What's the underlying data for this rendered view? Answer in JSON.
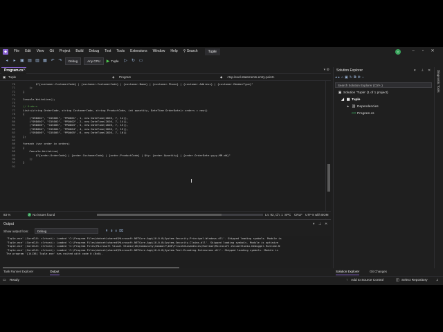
{
  "menu": {
    "items": [
      "File",
      "Edit",
      "View",
      "Git",
      "Project",
      "Build",
      "Debug",
      "Test",
      "Tools",
      "Extensions",
      "Window",
      "Help"
    ],
    "search_label": "Search",
    "solution_title": "Tuple",
    "avatar_initial": "T"
  },
  "toolbar": {
    "config": "Debug",
    "platform": "Any CPU",
    "run_label": "Tuple"
  },
  "editor": {
    "tab_label": "Program.cs",
    "nav_project": "Tuple",
    "nav_type": "Program",
    "nav_member": "<top-level-statements-entry-point>",
    "lines": [
      {
        "n": "70",
        "t": "        $\"{customer.CustomerCode} | {customer.CustomerCode} | {customer.Name} | {customer.Phone} | {customer.Address} | {customer.MemberType}\"",
        "c": ""
      },
      {
        "n": "71",
        "t": "    );",
        "c": ""
      },
      {
        "n": "72",
        "t": "}",
        "c": ""
      },
      {
        "n": "73",
        "t": "",
        "c": ""
      },
      {
        "n": "74",
        "t": "Console.WriteLine();",
        "c": ""
      },
      {
        "n": "75",
        "t": "",
        "c": ""
      },
      {
        "n": "76",
        "t": "// Orders",
        "c": "comment"
      },
      {
        "n": "77",
        "t": "List<(string OrderCode, string CustomerCode, string ProductCode, int quantity, DateTime OrderDate)> orders = new()",
        "c": ""
      },
      {
        "n": "78",
        "t": "{",
        "c": ""
      },
      {
        "n": "79",
        "t": "    (\"ORD001\", \"CUS001\", \"PRD001\", 1, new DateTime(2026, 7, 14)),",
        "c": ""
      },
      {
        "n": "80",
        "t": "    (\"ORD002\", \"CUS002\", \"PRD002\", 2, new DateTime(2026, 7, 14)),",
        "c": ""
      },
      {
        "n": "81",
        "t": "    (\"ORD003\", \"CUS003\", \"PRD003\", 5, new DateTime(2026, 7, 15)),",
        "c": ""
      },
      {
        "n": "82",
        "t": "    (\"ORD004\", \"CUS004\", \"PRD004\", 4, new DateTime(2026, 7, 15)),",
        "c": ""
      },
      {
        "n": "83",
        "t": "    (\"ORD005\", \"CUS005\", \"PRD005\", 6, new DateTime(2026, 7, 16))",
        "c": ""
      },
      {
        "n": "84",
        "t": "};",
        "c": ""
      },
      {
        "n": "85",
        "t": "",
        "c": ""
      },
      {
        "n": "86",
        "t": "foreach (var order in orders)",
        "c": ""
      },
      {
        "n": "87",
        "t": "{",
        "c": ""
      },
      {
        "n": "88",
        "t": "    Console.WriteLine(",
        "c": ""
      },
      {
        "n": "89",
        "t": "        $\"{order.OrderCode} | {order.CustomerCode} | {order.ProductCode} | Qty: {order.Quantity} | {order.OrderDate:yyyy-MM-dd}\"",
        "c": ""
      },
      {
        "n": "90",
        "t": "    );",
        "c": ""
      },
      {
        "n": "91",
        "t": "}",
        "c": ""
      },
      {
        "n": "92",
        "t": "",
        "c": ""
      }
    ]
  },
  "editor_status": {
    "zoom": "83 %",
    "issues": "No issues found",
    "position": "Ln: 92, Ch: 1",
    "whitespace": "SPC",
    "line_ending": "CRLF",
    "encoding": "UTF-8 with BOM"
  },
  "output": {
    "title": "Output",
    "show_from_label": "Show output from:",
    "source": "Debug",
    "lines": [
      "'Tuple.exe' (CoreCLR: clrhost): Loaded 'C:\\Program Files\\dotnet\\shared\\Microsoft.NETCore.App\\10.0.0\\System.Security.Principal.Windows.dll'. Skipped loading symbols. Module is",
      "'Tuple.exe' (CoreCLR: clrhost): Loaded 'C:\\Program Files\\dotnet\\shared\\Microsoft.NETCore.App\\10.0.0\\System.Security.Claims.dll'. Skipped loading symbols. Module is optimize",
      "'Tuple.exe' (CoreCLR: clrhost): Loaded 'C:\\Program Files\\Microsoft Visual Studio\\18\\Community\\Common7\\IDE\\PrivateAssemblies\\Runtime\\Microsoft.VisualStudio.Debugger.Runtime.N",
      "'Tuple.exe' (CoreCLR: clrhost): Loaded 'C:\\Program Files\\dotnet\\shared\\Microsoft.NETCore.App\\10.0.0\\System.Text.Encoding.Extensions.dll'. Skipped loading symbols. Module is",
      "The program '[14136] Tuple.exe' has exited with code 0 (0x0)."
    ]
  },
  "bottom_tabs": {
    "left": [
      "Task Runner Explorer",
      "Output"
    ],
    "right": [
      "Solution Explorer",
      "Git Changes"
    ]
  },
  "solution_explorer": {
    "title": "Solution Explorer",
    "search_placeholder": "Search Solution Explorer (Ctrl+;)",
    "solution": "Solution 'Tuple' (1 of 1 project)",
    "project": "Tuple",
    "dependencies": "Dependencies",
    "file": "Program.cs"
  },
  "rail": {
    "label": "Diagnostic Tools"
  },
  "statusbar": {
    "ready": "Ready",
    "source_control": "Add to Source Control",
    "repository": "Select Repository"
  },
  "colors": {
    "accent": "#8a63d2",
    "ok": "#3aa55d",
    "comment": "#57a64a"
  }
}
